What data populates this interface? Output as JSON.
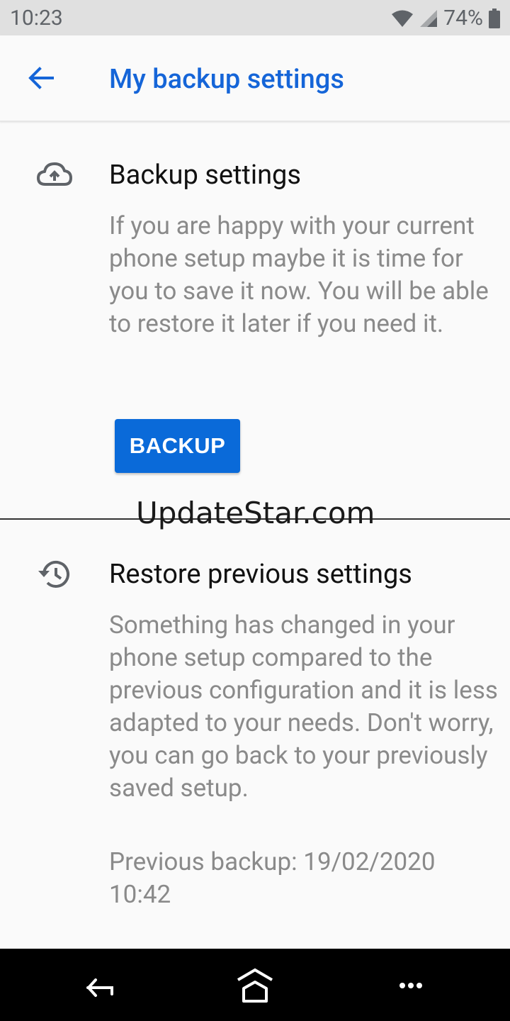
{
  "status_bar": {
    "time": "10:23",
    "battery_percent": "74%",
    "icons": [
      "wifi-icon",
      "cell-signal-icon",
      "battery-icon"
    ]
  },
  "app_bar": {
    "title": "My backup settings",
    "back_icon": "arrow-back-icon"
  },
  "backup_section": {
    "icon": "cloud-upload-icon",
    "title": "Backup settings",
    "description": "If you are happy with your current phone setup maybe it is time for you to save it now. You will be able to restore it later if you need it.",
    "button_label": "BACKUP"
  },
  "watermark": "UpdateStar.com",
  "restore_section": {
    "icon": "history-icon",
    "title": "Restore previous settings",
    "description": "Something has changed in your phone setup compared to the previous configuration and it is less adapted to your needs. Don't worry, you can go back to your previously saved setup.",
    "previous_backup": "Previous backup: 19/02/2020 10:42"
  },
  "nav_bar": {
    "buttons": [
      "back-nav-icon",
      "home-nav-icon",
      "more-nav-icon"
    ]
  },
  "colors": {
    "accent": "#1565d8",
    "button": "#0a6ad9",
    "status_bar_bg": "#e0e0e0",
    "page_bg": "#fafafa",
    "body_text_gray": "#8a8a8a",
    "nav_bar_bg": "#000000"
  }
}
